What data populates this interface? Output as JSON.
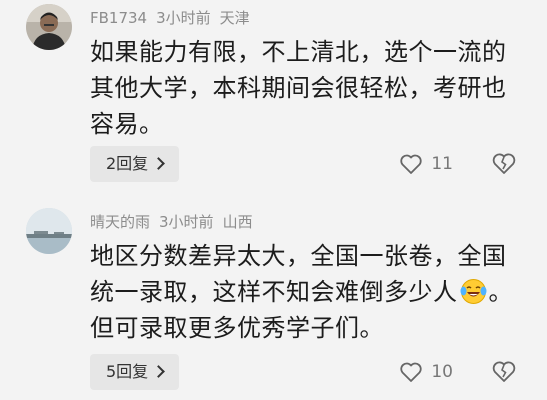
{
  "comments": [
    {
      "username": "FB1734",
      "time": "3小时前",
      "location": "天津",
      "lines": [
        "如果能力有限，不上清北，选个一流的",
        "其他大学，本科期间会很轻松，考研也",
        "容易。"
      ],
      "replies_label": "2回复",
      "likes": "11"
    },
    {
      "username": "晴天的雨",
      "time": "3小时前",
      "location": "山西",
      "lines": [
        "地区分数差异太大，全国一张卷，全国",
        "统一录取，这样不知会难倒多少人",
        "但可录取更多优秀学子们。"
      ],
      "line2_suffix": "。",
      "emoji": "laughing-crying-emoji",
      "replies_label": "5回复",
      "likes": "10"
    }
  ],
  "icons": {
    "like": "heart-outline-icon",
    "dislike": "broken-heart-icon",
    "replies": "chevron-right-icon"
  }
}
